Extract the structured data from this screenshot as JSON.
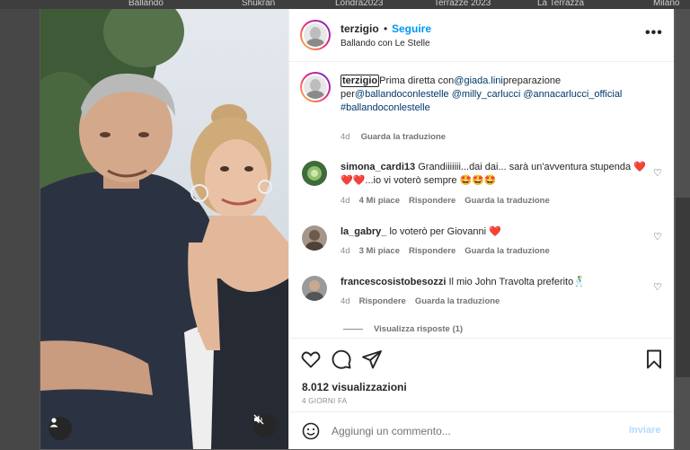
{
  "background_nav": [
    "Ballando",
    "Shukran",
    "Londra2023",
    "Terrazze 2023",
    "La Terrazza",
    "Milano"
  ],
  "post": {
    "username": "terzigio",
    "follow_dot": "•",
    "follow_label": "Seguire",
    "subtitle": "Ballando con Le Stelle",
    "more_icon": "more-horizontal-icon"
  },
  "caption": {
    "username": "terzigio",
    "text_1": "Prima diretta con",
    "mention_1": "@giada.lini",
    "text_2": "preparazione per",
    "mention_2": "@ballandoconlestelle",
    "mention_3": "@milly_carlucci",
    "mention_4": "@annacarlucci_official",
    "hashtag": "#ballandoconlestelle",
    "age": "4d",
    "translate": "Guarda la traduzione"
  },
  "comments": [
    {
      "username": "simona_cardi13",
      "text": "Grandiiiiiii...dai dai... sarà un'avventura stupenda ❤️❤️❤️...io vi voterò sempre 🤩🤩🤩",
      "age": "4d",
      "likes": "4 Mi piace",
      "reply": "Rispondere",
      "translate": "Guarda la traduzione"
    },
    {
      "username": "la_gabry_",
      "text": "lo voterò per Giovanni ❤️",
      "age": "4d",
      "likes": "3 Mi piace",
      "reply": "Rispondere",
      "translate": "Guarda la traduzione"
    },
    {
      "username": "francescosistobesozzi",
      "text": "Il mio John Travolta preferito🕺",
      "age": "4d",
      "likes": "",
      "reply": "Rispondere",
      "translate": "Guarda la traduzione"
    }
  ],
  "view_replies": "Visualizza risposte (1)",
  "actions": {
    "like_icon": "heart-icon",
    "comment_icon": "comment-icon",
    "share_icon": "share-icon",
    "save_icon": "bookmark-icon"
  },
  "views": "8.012 visualizzazioni",
  "time_ago": "4 GIORNI FA",
  "add_comment": {
    "placeholder": "Aggiungi un commento...",
    "post_label": "Inviare",
    "post_color": "#b3dbff"
  },
  "colors": {
    "accent": "#0095f6",
    "mention": "#00376b",
    "muted": "#8e8e8e"
  }
}
